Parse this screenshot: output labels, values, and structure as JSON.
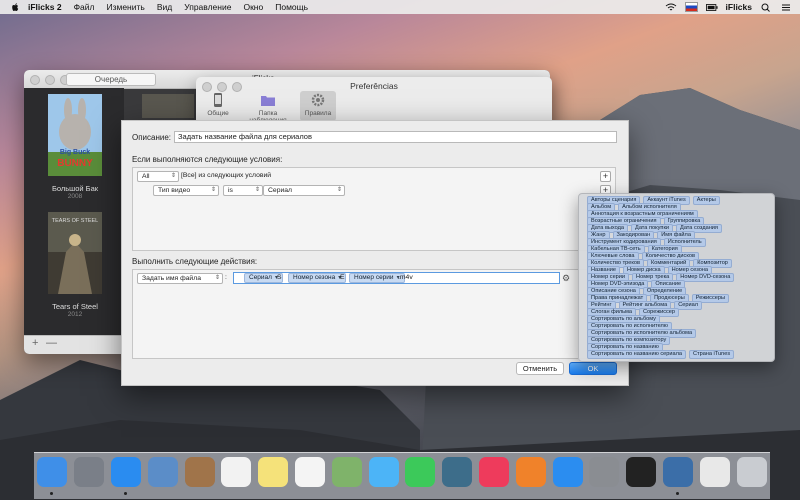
{
  "menubar": {
    "app_name": "iFlicks 2",
    "items": [
      "Файл",
      "Изменить",
      "Вид",
      "Управление",
      "Окно",
      "Помощь"
    ],
    "right_app": "iFlicks"
  },
  "queue_window": {
    "segment_label": "Очередь",
    "title": "iFlicks",
    "movies": [
      {
        "title": "Большой Бак",
        "year": "2008",
        "poster_text": "Big Buck BUNNY"
      },
      {
        "title": "Tears of Steel",
        "year": "2012",
        "poster_text": "TEARS OF STEEL"
      }
    ],
    "add_label": "+",
    "remove_label": "—"
  },
  "prefs_window": {
    "title": "Preferências",
    "tabs": [
      {
        "label": "Общие",
        "icon": "phone-icon"
      },
      {
        "label": "Папка наблюдения",
        "icon": "folder-icon"
      },
      {
        "label": "Правила",
        "icon": "gear-icon"
      }
    ]
  },
  "rule_sheet": {
    "description_label": "Описание:",
    "description_value": "Задать название файла для сериалов",
    "conditions_heading": "Если выполняются следующие условия:",
    "match_popup": "All",
    "match_text": "[Все] из следующих условий",
    "condition": {
      "field": "Тип видео",
      "operator": "is",
      "value": "Сериал"
    },
    "actions_heading": "Выполнить следующие действия:",
    "action": {
      "name": "Задать имя файла",
      "separator": ":",
      "token1": "Сериал",
      "text1": "S",
      "token2": "Номер сезона",
      "text2": "E",
      "token3": "Номер серии",
      "text3": ".m4v"
    },
    "plus_label": "+",
    "cancel_label": "Отменить",
    "ok_label": "OK"
  },
  "token_palette": {
    "rows": [
      [
        "Авторы сценария",
        "Аккаунт iTunes",
        "Актеры"
      ],
      [
        "Альбом",
        "Альбом исполнителя"
      ],
      [
        "Аннотация к возрастным ограничениям"
      ],
      [
        "Возрастные ограничения",
        "Группировка"
      ],
      [
        "Дата выхода",
        "Дата покупки",
        "Дата создания"
      ],
      [
        "Жанр",
        "Закодирован",
        "Имя файла"
      ],
      [
        "Инструмент кодирования",
        "Исполнитель"
      ],
      [
        "Кабельная ТВ-сеть",
        "Категория"
      ],
      [
        "Ключевые слова",
        "Количество дисков"
      ],
      [
        "Количество треков",
        "Комментарий",
        "Композитор"
      ],
      [
        "Название",
        "Номер диска",
        "Номер сезона"
      ],
      [
        "Номер серии",
        "Номер трека",
        "Номер DVD-сезона"
      ],
      [
        "Номер DVD-эпизода",
        "Описание"
      ],
      [
        "Описание сезона",
        "Определение"
      ],
      [
        "Права принадлежат",
        "Продюсеры",
        "Режиссеры"
      ],
      [
        "Рейтинг",
        "Рейтинг альбома",
        "Сериал"
      ],
      [
        "Слоган фильма",
        "Сорежиссер"
      ],
      [
        "Сортировать по альбому"
      ],
      [
        "Сортировать по исполнителю"
      ],
      [
        "Сортировать по исполнителю альбома"
      ],
      [
        "Сортировать по композитору"
      ],
      [
        "Сортировать по названию"
      ],
      [
        "Сортировать по названию сериала",
        "Страна iTunes"
      ]
    ]
  },
  "dock": {
    "apps": [
      {
        "icon": "finder-icon",
        "color": "#3f8fe8",
        "running": true
      },
      {
        "icon": "launchpad-icon",
        "color": "#7a7f88",
        "running": false
      },
      {
        "icon": "safari-icon",
        "color": "#2a8cf0",
        "running": true
      },
      {
        "icon": "preview-photos-icon",
        "color": "#5b8dc8",
        "running": false
      },
      {
        "icon": "contacts-icon",
        "color": "#a0744a",
        "running": false
      },
      {
        "icon": "calendar-icon",
        "color": "#f2f2f2",
        "running": false
      },
      {
        "icon": "notes-icon",
        "color": "#f5e27a",
        "running": false
      },
      {
        "icon": "reminders-icon",
        "color": "#f4f4f4",
        "running": false
      },
      {
        "icon": "maps-icon",
        "color": "#7fb36a",
        "running": false
      },
      {
        "icon": "messages-icon",
        "color": "#4cb4f7",
        "running": false
      },
      {
        "icon": "facetime-icon",
        "color": "#3cc95a",
        "running": false
      },
      {
        "icon": "iphoto-icon",
        "color": "#3d6d8a",
        "running": false
      },
      {
        "icon": "itunes-icon",
        "color": "#ee3b5c",
        "running": false
      },
      {
        "icon": "ibooks-icon",
        "color": "#f0822a",
        "running": false
      },
      {
        "icon": "app-store-icon",
        "color": "#2b8df0",
        "running": false
      },
      {
        "icon": "system-preferences-icon",
        "color": "#8a8d92",
        "running": false
      },
      {
        "icon": "terminal-icon",
        "color": "#222222",
        "running": false
      },
      {
        "icon": "iflicks-icon",
        "color": "#3b6ea8",
        "running": true
      },
      {
        "icon": "pdf-document-icon",
        "color": "#e8e8e8",
        "running": false
      },
      {
        "icon": "trash-icon",
        "color": "#c9ccd1",
        "running": false
      }
    ]
  }
}
